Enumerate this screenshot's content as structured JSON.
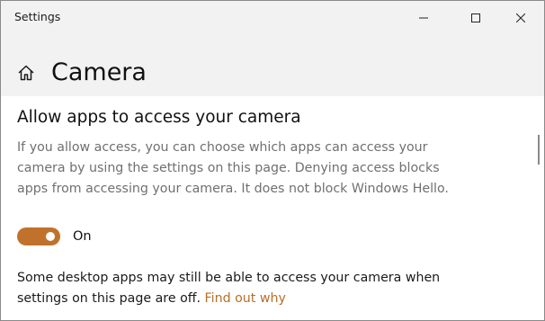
{
  "window": {
    "title": "Settings"
  },
  "header": {
    "page_title": "Camera",
    "home_icon": "home-icon"
  },
  "section": {
    "heading": "Allow apps to access your camera",
    "description_lines": [
      "If you allow access, you can choose which apps can access your",
      "camera by using the settings on this page. Denying access blocks",
      "apps from accessing your camera. It does not block Windows Hello."
    ]
  },
  "toggle": {
    "state": "On",
    "is_on": true,
    "color": "#c0722c"
  },
  "note": {
    "line1": "Some desktop apps may still be able to access your camera when",
    "line2_prefix": "settings on this page are off.",
    "link_text": "Find out why"
  },
  "colors": {
    "accent": "#c0722c",
    "link": "#b86e28",
    "header_bg": "#f2f2f2"
  }
}
